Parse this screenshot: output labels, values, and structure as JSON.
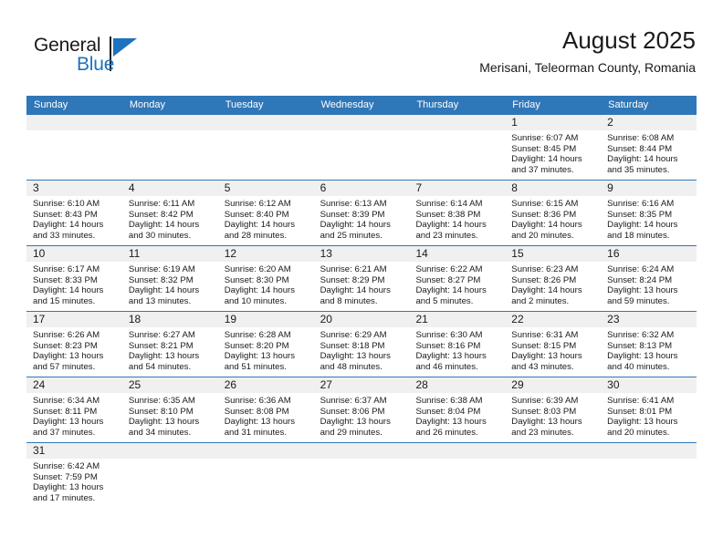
{
  "brand": {
    "name_part1": "General",
    "name_part2": "Blue",
    "logo_icon": "blue-triangle-logo"
  },
  "header": {
    "title": "August 2025",
    "subtitle": "Merisani, Teleorman County, Romania"
  },
  "colors": {
    "header_blue": "#2f77b8",
    "brand_blue": "#1d72bd",
    "day_band_gray": "#f0f0f0",
    "text": "#1a1a1a"
  },
  "calendar": {
    "weekday_headers": [
      "Sunday",
      "Monday",
      "Tuesday",
      "Wednesday",
      "Thursday",
      "Friday",
      "Saturday"
    ],
    "weeks": [
      [
        {
          "day": "",
          "empty": true,
          "lines": []
        },
        {
          "day": "",
          "empty": true,
          "lines": []
        },
        {
          "day": "",
          "empty": true,
          "lines": []
        },
        {
          "day": "",
          "empty": true,
          "lines": []
        },
        {
          "day": "",
          "empty": true,
          "lines": []
        },
        {
          "day": "1",
          "empty": false,
          "lines": [
            "Sunrise: 6:07 AM",
            "Sunset: 8:45 PM",
            "Daylight: 14 hours",
            "and 37 minutes."
          ]
        },
        {
          "day": "2",
          "empty": false,
          "lines": [
            "Sunrise: 6:08 AM",
            "Sunset: 8:44 PM",
            "Daylight: 14 hours",
            "and 35 minutes."
          ]
        }
      ],
      [
        {
          "day": "3",
          "empty": false,
          "lines": [
            "Sunrise: 6:10 AM",
            "Sunset: 8:43 PM",
            "Daylight: 14 hours",
            "and 33 minutes."
          ]
        },
        {
          "day": "4",
          "empty": false,
          "lines": [
            "Sunrise: 6:11 AM",
            "Sunset: 8:42 PM",
            "Daylight: 14 hours",
            "and 30 minutes."
          ]
        },
        {
          "day": "5",
          "empty": false,
          "lines": [
            "Sunrise: 6:12 AM",
            "Sunset: 8:40 PM",
            "Daylight: 14 hours",
            "and 28 minutes."
          ]
        },
        {
          "day": "6",
          "empty": false,
          "lines": [
            "Sunrise: 6:13 AM",
            "Sunset: 8:39 PM",
            "Daylight: 14 hours",
            "and 25 minutes."
          ]
        },
        {
          "day": "7",
          "empty": false,
          "lines": [
            "Sunrise: 6:14 AM",
            "Sunset: 8:38 PM",
            "Daylight: 14 hours",
            "and 23 minutes."
          ]
        },
        {
          "day": "8",
          "empty": false,
          "lines": [
            "Sunrise: 6:15 AM",
            "Sunset: 8:36 PM",
            "Daylight: 14 hours",
            "and 20 minutes."
          ]
        },
        {
          "day": "9",
          "empty": false,
          "lines": [
            "Sunrise: 6:16 AM",
            "Sunset: 8:35 PM",
            "Daylight: 14 hours",
            "and 18 minutes."
          ]
        }
      ],
      [
        {
          "day": "10",
          "empty": false,
          "lines": [
            "Sunrise: 6:17 AM",
            "Sunset: 8:33 PM",
            "Daylight: 14 hours",
            "and 15 minutes."
          ]
        },
        {
          "day": "11",
          "empty": false,
          "lines": [
            "Sunrise: 6:19 AM",
            "Sunset: 8:32 PM",
            "Daylight: 14 hours",
            "and 13 minutes."
          ]
        },
        {
          "day": "12",
          "empty": false,
          "lines": [
            "Sunrise: 6:20 AM",
            "Sunset: 8:30 PM",
            "Daylight: 14 hours",
            "and 10 minutes."
          ]
        },
        {
          "day": "13",
          "empty": false,
          "lines": [
            "Sunrise: 6:21 AM",
            "Sunset: 8:29 PM",
            "Daylight: 14 hours",
            "and 8 minutes."
          ]
        },
        {
          "day": "14",
          "empty": false,
          "lines": [
            "Sunrise: 6:22 AM",
            "Sunset: 8:27 PM",
            "Daylight: 14 hours",
            "and 5 minutes."
          ]
        },
        {
          "day": "15",
          "empty": false,
          "lines": [
            "Sunrise: 6:23 AM",
            "Sunset: 8:26 PM",
            "Daylight: 14 hours",
            "and 2 minutes."
          ]
        },
        {
          "day": "16",
          "empty": false,
          "lines": [
            "Sunrise: 6:24 AM",
            "Sunset: 8:24 PM",
            "Daylight: 13 hours",
            "and 59 minutes."
          ]
        }
      ],
      [
        {
          "day": "17",
          "empty": false,
          "lines": [
            "Sunrise: 6:26 AM",
            "Sunset: 8:23 PM",
            "Daylight: 13 hours",
            "and 57 minutes."
          ]
        },
        {
          "day": "18",
          "empty": false,
          "lines": [
            "Sunrise: 6:27 AM",
            "Sunset: 8:21 PM",
            "Daylight: 13 hours",
            "and 54 minutes."
          ]
        },
        {
          "day": "19",
          "empty": false,
          "lines": [
            "Sunrise: 6:28 AM",
            "Sunset: 8:20 PM",
            "Daylight: 13 hours",
            "and 51 minutes."
          ]
        },
        {
          "day": "20",
          "empty": false,
          "lines": [
            "Sunrise: 6:29 AM",
            "Sunset: 8:18 PM",
            "Daylight: 13 hours",
            "and 48 minutes."
          ]
        },
        {
          "day": "21",
          "empty": false,
          "lines": [
            "Sunrise: 6:30 AM",
            "Sunset: 8:16 PM",
            "Daylight: 13 hours",
            "and 46 minutes."
          ]
        },
        {
          "day": "22",
          "empty": false,
          "lines": [
            "Sunrise: 6:31 AM",
            "Sunset: 8:15 PM",
            "Daylight: 13 hours",
            "and 43 minutes."
          ]
        },
        {
          "day": "23",
          "empty": false,
          "lines": [
            "Sunrise: 6:32 AM",
            "Sunset: 8:13 PM",
            "Daylight: 13 hours",
            "and 40 minutes."
          ]
        }
      ],
      [
        {
          "day": "24",
          "empty": false,
          "lines": [
            "Sunrise: 6:34 AM",
            "Sunset: 8:11 PM",
            "Daylight: 13 hours",
            "and 37 minutes."
          ]
        },
        {
          "day": "25",
          "empty": false,
          "lines": [
            "Sunrise: 6:35 AM",
            "Sunset: 8:10 PM",
            "Daylight: 13 hours",
            "and 34 minutes."
          ]
        },
        {
          "day": "26",
          "empty": false,
          "lines": [
            "Sunrise: 6:36 AM",
            "Sunset: 8:08 PM",
            "Daylight: 13 hours",
            "and 31 minutes."
          ]
        },
        {
          "day": "27",
          "empty": false,
          "lines": [
            "Sunrise: 6:37 AM",
            "Sunset: 8:06 PM",
            "Daylight: 13 hours",
            "and 29 minutes."
          ]
        },
        {
          "day": "28",
          "empty": false,
          "lines": [
            "Sunrise: 6:38 AM",
            "Sunset: 8:04 PM",
            "Daylight: 13 hours",
            "and 26 minutes."
          ]
        },
        {
          "day": "29",
          "empty": false,
          "lines": [
            "Sunrise: 6:39 AM",
            "Sunset: 8:03 PM",
            "Daylight: 13 hours",
            "and 23 minutes."
          ]
        },
        {
          "day": "30",
          "empty": false,
          "lines": [
            "Sunrise: 6:41 AM",
            "Sunset: 8:01 PM",
            "Daylight: 13 hours",
            "and 20 minutes."
          ]
        }
      ],
      [
        {
          "day": "31",
          "empty": false,
          "lines": [
            "Sunrise: 6:42 AM",
            "Sunset: 7:59 PM",
            "Daylight: 13 hours",
            "and 17 minutes."
          ]
        },
        {
          "day": "",
          "empty": true,
          "lines": []
        },
        {
          "day": "",
          "empty": true,
          "lines": []
        },
        {
          "day": "",
          "empty": true,
          "lines": []
        },
        {
          "day": "",
          "empty": true,
          "lines": []
        },
        {
          "day": "",
          "empty": true,
          "lines": []
        },
        {
          "day": "",
          "empty": true,
          "lines": []
        }
      ]
    ]
  }
}
